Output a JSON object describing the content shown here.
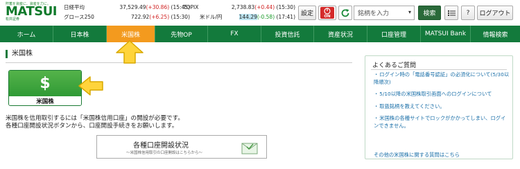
{
  "logo": {
    "tagline": "貯蓄を資産に、資産を力に。",
    "brand": "MATSUI",
    "sub": "松井証券"
  },
  "quotes": [
    {
      "name": "日経平均",
      "value": "37,529.49",
      "change": "(+30.86)",
      "change_sign": "pos_red",
      "time": "(15:45)"
    },
    {
      "name": "グロース250",
      "value": "722.92",
      "change": "(+6.25)",
      "change_sign": "pos_red",
      "time": "(15:30)"
    },
    {
      "name": "TOPIX",
      "value": "2,738.83",
      "change": "(+0.44)",
      "change_sign": "pos_red",
      "time": "(15:30)"
    },
    {
      "name": "米ドル/円",
      "value": "144.29",
      "change": "(-0.58)",
      "change_sign": "neg_green",
      "time": "(17:41)"
    }
  ],
  "header": {
    "settings_label": "設定",
    "on_label": "ON",
    "search_placeholder": "銘柄を入力",
    "search_button": "検索",
    "help_label": "?",
    "logout_label": "ログアウト"
  },
  "nav": {
    "items": [
      {
        "label": "ホーム",
        "active": false
      },
      {
        "label": "日本株",
        "active": false
      },
      {
        "label": "米国株",
        "active": true
      },
      {
        "label": "先物OP",
        "active": false
      },
      {
        "label": "FX",
        "active": false
      },
      {
        "label": "投資信託",
        "active": false
      },
      {
        "label": "資産状況",
        "active": false
      },
      {
        "label": "口座管理",
        "active": false
      },
      {
        "label": "MATSUI Bank",
        "active": false
      },
      {
        "label": "情報検索",
        "active": false
      }
    ]
  },
  "main": {
    "title": "米国株",
    "us_button": {
      "icon_text": "$",
      "label": "米国株"
    },
    "description_lines": [
      "米国株を信用取引するには「米国株信用口座」の開設が必要です。",
      "各種口座開設状況ボタンから、口座開設手続きをお願いします。"
    ],
    "status_button": {
      "title": "各種口座開設状況",
      "subtitle": "〜米国株信用取引の口座開設はこちらから〜"
    }
  },
  "faq": {
    "title": "よくあるご質問",
    "items": [
      "ログイン時の「電話番号認証」の必須化について(5/30以降順次)",
      "5/10以降の米国株取引画面へのログインについて",
      "取扱銘柄を教えてください。",
      "米国株の各種サイトでロックがかかってしまい、ログインできません。"
    ],
    "more_link": "その他の米国株に関する質問はこちら"
  },
  "colors": {
    "nav_green": "#137a3c",
    "active_orange": "#f39a1e",
    "arrow_yellow": "#ffd43b",
    "link_blue": "#1a6fa8"
  },
  "icons": [
    "dollar-icon",
    "mail-icon",
    "refresh-icon",
    "list-icon",
    "on-toggle-icon",
    "chevron-down-icon",
    "arrow-annotation-icon"
  ]
}
